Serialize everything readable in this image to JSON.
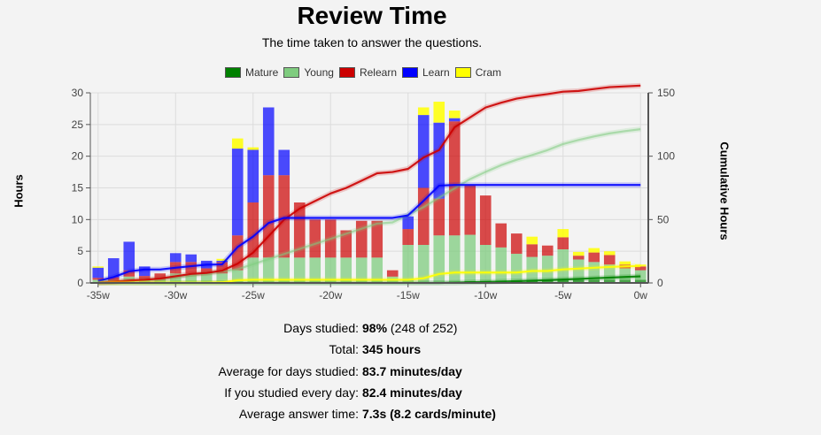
{
  "page": {
    "title": "Review Time",
    "subtitle": "The time taken to answer the questions."
  },
  "legend": [
    {
      "label": "Mature",
      "color": "#008000"
    },
    {
      "label": "Young",
      "color": "#7fcc7f"
    },
    {
      "label": "Relearn",
      "color": "#cc0000"
    },
    {
      "label": "Learn",
      "color": "#0000ff"
    },
    {
      "label": "Cram",
      "color": "#ffff00"
    }
  ],
  "stats": [
    {
      "label": "Days studied:",
      "value": "98%",
      "extra": " (248 of 252)"
    },
    {
      "label": "Total:",
      "value": "345 hours",
      "extra": ""
    },
    {
      "label": "Average for days studied:",
      "value": "83.7 minutes/day",
      "extra": ""
    },
    {
      "label": "If you studied every day:",
      "value": "82.4 minutes/day",
      "extra": ""
    },
    {
      "label": "Average answer time:",
      "value": "7.3s (8.2 cards/minute)",
      "extra": ""
    }
  ],
  "chart_data": {
    "type": "bar",
    "stacked": true,
    "title": "Review Time",
    "subtitle": "The time taken to answer the questions.",
    "xlabel": "",
    "ylabel": "Hours",
    "y2label": "Cumulative Hours",
    "xlim": [
      -35.5,
      0.5
    ],
    "ylim": [
      0,
      30
    ],
    "y2lim": [
      0,
      150
    ],
    "x_ticks": [
      -35,
      -30,
      -25,
      -20,
      -15,
      -10,
      -5,
      0
    ],
    "x_tick_labels": [
      "-35w",
      "-30w",
      "-25w",
      "-20w",
      "-15w",
      "-10w",
      "-5w",
      "0w"
    ],
    "y_ticks": [
      0,
      5,
      10,
      15,
      20,
      25,
      30
    ],
    "y2_ticks": [
      0,
      50,
      100,
      150
    ],
    "grid": true,
    "legend_position": "top-center",
    "x": [
      -35,
      -34,
      -33,
      -32,
      -31,
      -30,
      -29,
      -28,
      -27,
      -26,
      -25,
      -24,
      -23,
      -22,
      -21,
      -20,
      -19,
      -18,
      -17,
      -16,
      -15,
      -14,
      -13,
      -12,
      -11,
      -10,
      -9,
      -8,
      -7,
      -6,
      -5,
      -4,
      -3,
      -2,
      -1,
      0
    ],
    "series": [
      {
        "name": "Mature",
        "color": "#008000",
        "values": [
          0,
          0,
          0,
          0,
          0,
          0,
          0,
          0,
          0,
          0,
          0,
          0,
          0,
          0,
          0,
          0,
          0,
          0,
          0,
          0,
          0,
          0,
          0,
          0.2,
          0.3,
          0.3,
          0.3,
          0.3,
          0.4,
          0.4,
          0.5,
          0.5,
          0.5,
          0.5,
          0.5,
          0.5
        ]
      },
      {
        "name": "Young",
        "color": "#7fcc7f",
        "values": [
          0.5,
          0.3,
          1,
          0.5,
          0.5,
          1.5,
          1.5,
          1.5,
          1.5,
          2,
          4,
          4,
          4,
          4,
          4,
          4,
          4,
          4,
          4,
          1,
          6,
          6,
          7.5,
          7.3,
          7.3,
          5.7,
          5.3,
          4.3,
          3.7,
          3.9,
          4.8,
          3.2,
          2.8,
          2.4,
          1.8,
          1.5
        ]
      },
      {
        "name": "Relearn",
        "color": "#cc0000",
        "values": [
          0.3,
          0.6,
          1,
          0.6,
          1,
          1.8,
          1.8,
          0.8,
          1.8,
          5.5,
          8.7,
          13,
          13,
          8.7,
          6,
          6,
          4.3,
          5.8,
          5.8,
          1,
          2.5,
          9,
          5.8,
          18,
          7.8,
          7.8,
          3.8,
          3.2,
          2,
          1.6,
          1.9,
          0.6,
          1.5,
          1.5,
          0.6,
          0.6
        ]
      },
      {
        "name": "Learn",
        "color": "#0000ff",
        "values": [
          1.6,
          3,
          4.5,
          1.5,
          0,
          1.4,
          1.2,
          1.2,
          0.2,
          13.7,
          8.3,
          10.7,
          4,
          0,
          0,
          0,
          0,
          0,
          0,
          0,
          2,
          11.5,
          12,
          0.5,
          0,
          0,
          0,
          0,
          0,
          0,
          0,
          0,
          0,
          0,
          0,
          0
        ]
      },
      {
        "name": "Cram",
        "color": "#ffff00",
        "values": [
          0.2,
          0,
          0,
          0,
          0,
          0,
          0,
          0,
          0.3,
          1.6,
          0.4,
          0,
          0,
          0,
          0,
          0,
          0,
          0,
          0,
          0,
          0,
          1.2,
          3.3,
          1.2,
          0,
          0,
          0,
          0,
          1.2,
          0,
          1.3,
          0.6,
          0.7,
          0.6,
          0.5,
          0.3
        ]
      }
    ],
    "cumulative": [
      {
        "name": "Mature",
        "color": "#008000",
        "values": [
          0,
          0,
          0,
          0,
          0,
          0,
          0,
          0,
          0,
          0,
          0,
          0,
          0,
          0,
          0,
          0,
          0,
          0,
          0,
          0,
          0,
          0,
          0,
          0.2,
          0.5,
          0.8,
          1.1,
          1.4,
          1.8,
          2.2,
          2.7,
          3.2,
          3.7,
          4.2,
          4.7,
          5.2
        ]
      },
      {
        "name": "Young",
        "color": "#7fcc7f",
        "values": [
          0.5,
          0.8,
          1.8,
          2.3,
          2.8,
          4.3,
          5.8,
          7.3,
          8.8,
          10.8,
          14.8,
          18.8,
          22.8,
          26.8,
          30.8,
          34.8,
          38.8,
          42.8,
          46.8,
          47.8,
          53.8,
          59.8,
          67.3,
          74.6,
          81.9,
          87.6,
          92.9,
          97.2,
          100.9,
          104.8,
          109.6,
          112.8,
          115.6,
          118,
          119.8,
          121.3
        ]
      },
      {
        "name": "Relearn",
        "color": "#cc0000",
        "values": [
          0.3,
          0.9,
          1.9,
          2.5,
          3.5,
          5.3,
          7.1,
          7.9,
          9.7,
          15.2,
          23.9,
          36.9,
          49.9,
          58.6,
          64.6,
          70.6,
          74.9,
          80.7,
          86.5,
          87.5,
          90,
          99,
          104.8,
          122.8,
          130.6,
          138.4,
          142.2,
          145.4,
          147.4,
          149,
          150.9,
          151.5,
          153,
          154.5,
          155.1,
          155.7
        ]
      },
      {
        "name": "Learn",
        "color": "#0000ff",
        "values": [
          1.6,
          4.6,
          9.1,
          10.6,
          10.6,
          12,
          13.2,
          14.4,
          14.6,
          28.3,
          36.6,
          47.3,
          51.3,
          51.3,
          51.3,
          51.3,
          51.3,
          51.3,
          51.3,
          51.3,
          53.3,
          64.8,
          76.8,
          77.3,
          77.3,
          77.3,
          77.3,
          77.3,
          77.3,
          77.3,
          77.3,
          77.3,
          77.3,
          77.3,
          77.3,
          77.3
        ]
      },
      {
        "name": "Cram",
        "color": "#ffff00",
        "values": [
          0.2,
          0.2,
          0.2,
          0.2,
          0.2,
          0.2,
          0.2,
          0.2,
          0.5,
          2.1,
          2.5,
          2.5,
          2.5,
          2.5,
          2.5,
          2.5,
          2.5,
          2.5,
          2.5,
          2.5,
          2.5,
          3.7,
          7,
          8.2,
          8.2,
          8.2,
          8.2,
          8.2,
          9.4,
          9.4,
          10.7,
          11.3,
          12,
          12.6,
          13.1,
          13.4
        ]
      }
    ]
  }
}
